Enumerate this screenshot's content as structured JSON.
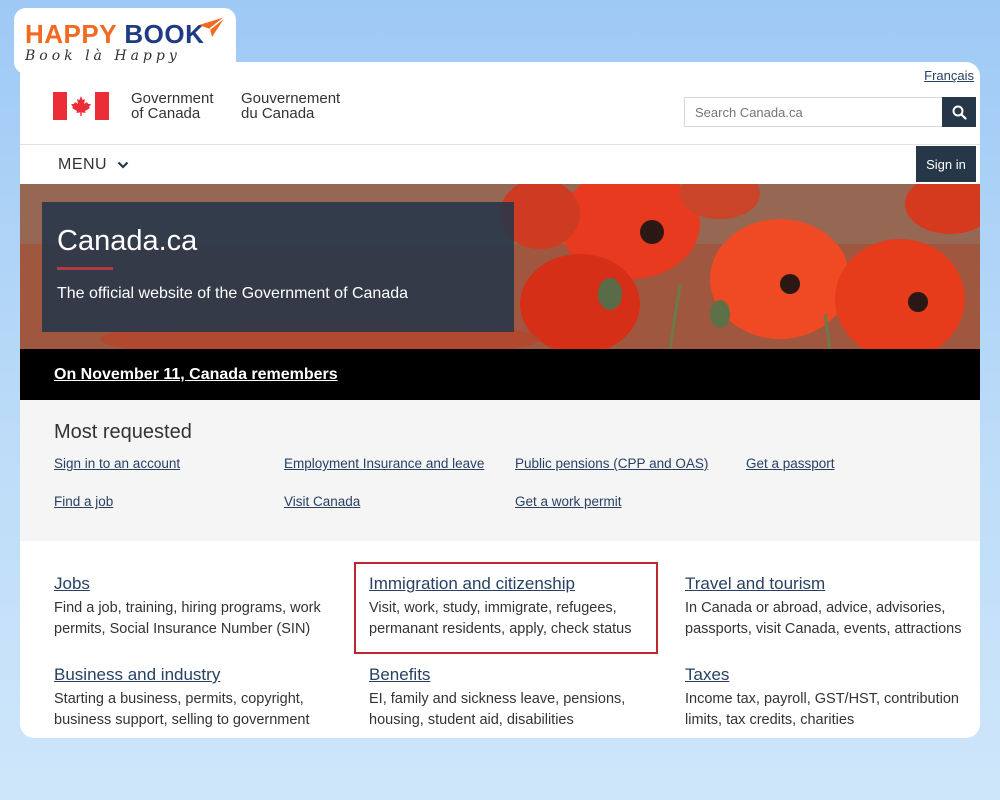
{
  "watermark": {
    "word1": "HAPPY",
    "word2": "BOOK",
    "tagline": "Book là Happy",
    "accent": "#f26a21",
    "brand": "#1f3b86"
  },
  "header": {
    "language_link": "Français",
    "signature_en_line1": "Government",
    "signature_en_line2": "of Canada",
    "signature_fr_line1": "Gouvernement",
    "signature_fr_line2": "du Canada",
    "search_placeholder": "Search Canada.ca",
    "menu_label": "MENU",
    "signin_label": "Sign in"
  },
  "hero": {
    "title": "Canada.ca",
    "subtitle": "The official website of the Government of Canada"
  },
  "banner": {
    "link": "On November 11, Canada remembers"
  },
  "most_requested": {
    "title": "Most requested",
    "links": [
      "Sign in to an account",
      "Employment Insurance and leave",
      "Public pensions (CPP and OAS)",
      "Get a passport",
      "Find a job",
      "Visit Canada",
      "Get a work permit"
    ]
  },
  "topics": [
    {
      "title": "Jobs",
      "desc": "Find a job, training, hiring programs, work permits, Social Insurance Number (SIN)"
    },
    {
      "title": "Immigration and citizenship",
      "desc": "Visit, work, study, immigrate, refugees, permanant residents, apply, check status"
    },
    {
      "title": "Travel and tourism",
      "desc": "In Canada or abroad, advice, advisories, passports, visit Canada, events, attractions"
    },
    {
      "title": "Business and industry",
      "desc": "Starting a business, permits, copyright, business support, selling to government"
    },
    {
      "title": "Benefits",
      "desc": "EI, family and sickness leave, pensions, housing, student aid, disabilities"
    },
    {
      "title": "Taxes",
      "desc": "Income tax, payroll, GST/HST, contribution limits, tax credits, charities"
    }
  ],
  "colors": {
    "primary_dark": "#26374a",
    "link": "#284162",
    "flag_red": "#eb2d37",
    "highlight": "#c0262d"
  }
}
